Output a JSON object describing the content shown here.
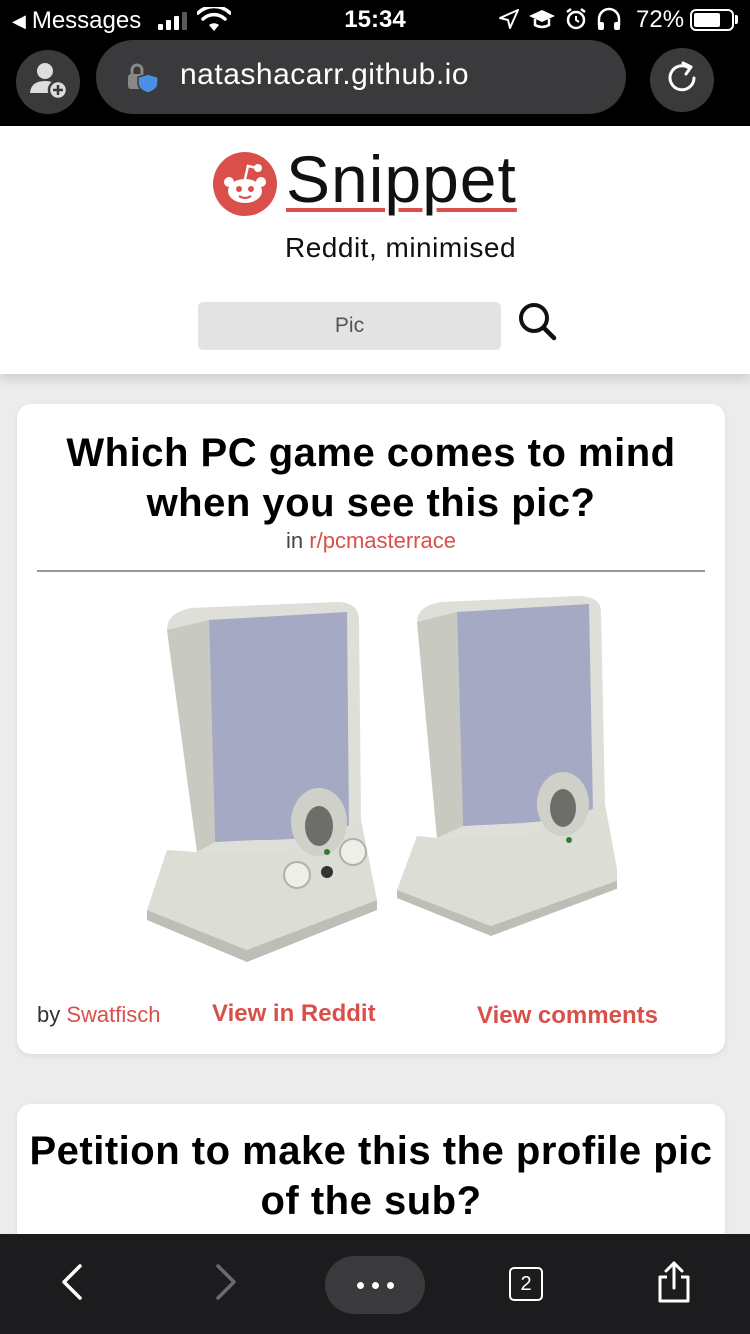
{
  "status_bar": {
    "back_app": "Messages",
    "time": "15:34",
    "battery_percent": "72%",
    "battery_level": 0.72,
    "signal_bars": 4
  },
  "browser": {
    "url": "natashacarr.github.io",
    "tab_count": "2"
  },
  "header": {
    "brand": "Snippet",
    "tagline": "Reddit, minimised",
    "search_value": "Pic"
  },
  "posts": [
    {
      "title": "Which PC game comes to mind when you see this pic?",
      "sub_prefix": "in",
      "subreddit": "r/pcmasterrace",
      "by_label": "by",
      "author": "Swatfisch",
      "view_reddit": "View in Reddit",
      "view_comments": "View comments"
    },
    {
      "title": "Petition to make this the profile pic of the sub?"
    }
  ],
  "colors": {
    "accent": "#d94f4a",
    "chrome": "#000000",
    "toolbar": "#1c1c1e"
  },
  "icons": {
    "profile": "add-profile-icon",
    "lock": "lock-shield-icon",
    "reload": "reload-icon",
    "search": "search-icon",
    "back": "chevron-left-icon",
    "forward": "chevron-right-icon",
    "menu": "more-dots-icon",
    "tabs": "tabs-icon",
    "share": "share-icon"
  }
}
